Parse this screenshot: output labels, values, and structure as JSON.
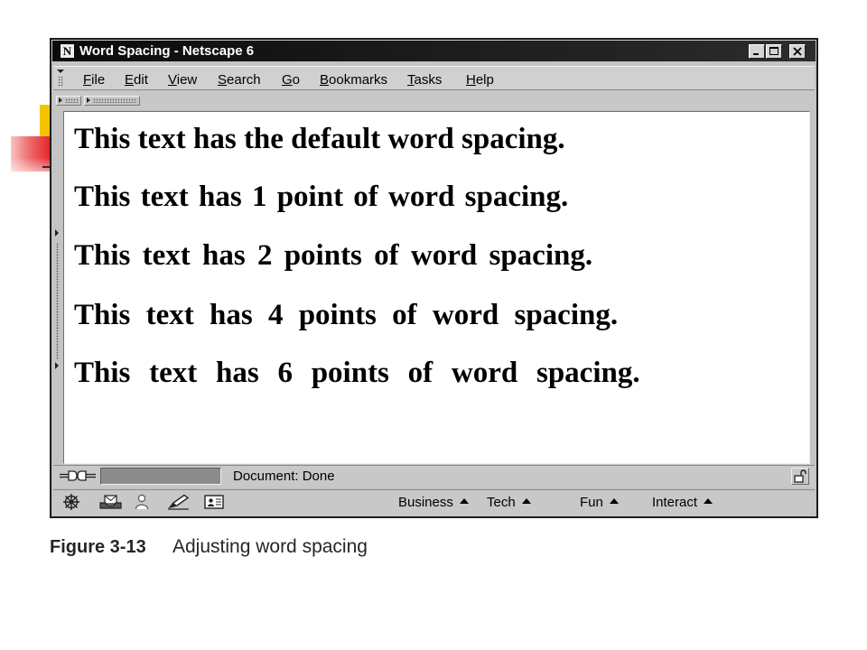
{
  "window": {
    "title": "Word Spacing - Netscape 6",
    "app_icon": "netscape-n-icon",
    "app_icon_letter": "N",
    "controls": [
      "minimize-icon",
      "maximize-icon",
      "close-icon"
    ]
  },
  "menu_bar": {
    "items": [
      "File",
      "Edit",
      "View",
      "Search",
      "Go",
      "Bookmarks",
      "Tasks",
      "Help"
    ]
  },
  "content": {
    "lines": [
      "This text has the default word spacing.",
      "This text has 1 point of word spacing.",
      "This text has 2 points of word spacing.",
      "This text has 4 points of word spacing.",
      "This text has 6 points of word spacing."
    ]
  },
  "status_bar": {
    "connection_icon": "online-plug-icon",
    "text": "Document: Done",
    "security_icon": "unlocked-padlock-icon"
  },
  "component_bar": {
    "icons": [
      "navigator-icon",
      "mail-icon",
      "instant-messenger-icon",
      "composer-icon",
      "address-book-icon"
    ],
    "menus": [
      "Business",
      "Tech",
      "Fun",
      "Interact"
    ]
  },
  "caption": {
    "label": "Figure 3-13",
    "text": "Adjusting word spacing"
  },
  "colors": {
    "title_bar": "#141414",
    "title_text": "#ffffff",
    "chrome": "#c4c4c4",
    "content_background": "#ffffff",
    "slide_accent_yellow": "#f5c400",
    "slide_accent_red": "#e4262c"
  }
}
